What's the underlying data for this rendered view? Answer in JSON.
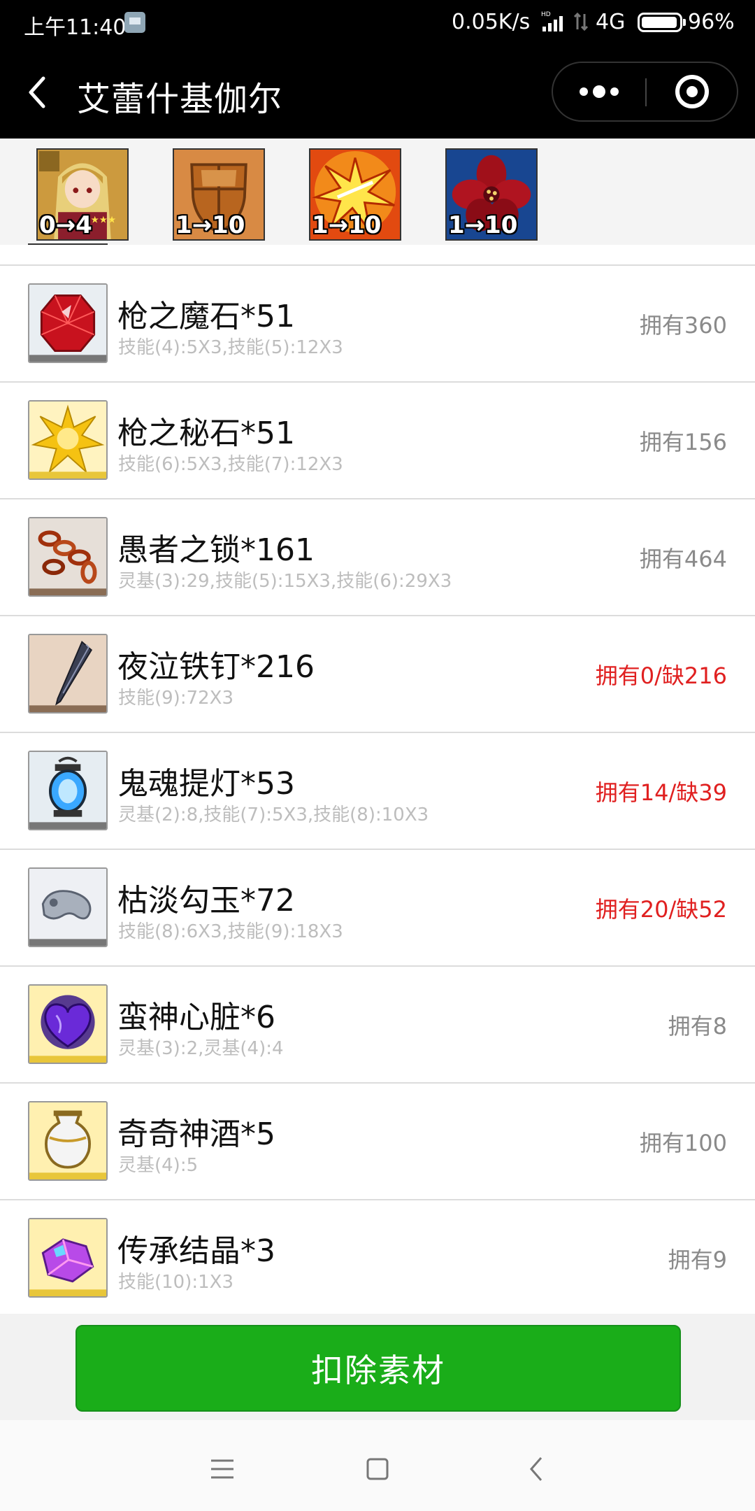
{
  "status_bar": {
    "time": "上午11:40",
    "net_speed": "0.05K/s",
    "network": "4G",
    "battery": "96%"
  },
  "header": {
    "title": "艾蕾什基伽尔"
  },
  "tabs": [
    {
      "label": "0→4",
      "icon": "servant-portrait"
    },
    {
      "label": "1→10",
      "icon": "shield-skill-icon"
    },
    {
      "label": "1→10",
      "icon": "burst-skill-icon"
    },
    {
      "label": "1→10",
      "icon": "red-flower-skill-icon"
    }
  ],
  "materials": [
    {
      "name": "枪之魔石*51",
      "detail": "技能(4):5X3,技能(5):12X3",
      "owned": "拥有360",
      "short": false,
      "icon": "red-gem-icon"
    },
    {
      "name": "枪之秘石*51",
      "detail": "技能(6):5X3,技能(7):12X3",
      "owned": "拥有156",
      "short": false,
      "icon": "gold-star-gem-icon"
    },
    {
      "name": "愚者之锁*161",
      "detail": "灵基(3):29,技能(5):15X3,技能(6):29X3",
      "owned": "拥有464",
      "short": false,
      "icon": "chain-icon"
    },
    {
      "name": "夜泣铁钉*216",
      "detail": "技能(9):72X3",
      "owned": "拥有0/缺216",
      "short": true,
      "icon": "iron-nail-icon"
    },
    {
      "name": "鬼魂提灯*53",
      "detail": "灵基(2):8,技能(7):5X3,技能(8):10X3",
      "owned": "拥有14/缺39",
      "short": true,
      "icon": "lantern-icon"
    },
    {
      "name": "枯淡勾玉*72",
      "detail": "技能(8):6X3,技能(9):18X3",
      "owned": "拥有20/缺52",
      "short": true,
      "icon": "magatama-icon"
    },
    {
      "name": "蛮神心脏*6",
      "detail": "灵基(3):2,灵基(4):4",
      "owned": "拥有8",
      "short": false,
      "icon": "heart-icon"
    },
    {
      "name": "奇奇神酒*5",
      "detail": "灵基(4):5",
      "owned": "拥有100",
      "short": false,
      "icon": "wine-jar-icon"
    },
    {
      "name": "传承结晶*3",
      "detail": "技能(10):1X3",
      "owned": "拥有9",
      "short": false,
      "icon": "crystal-icon"
    }
  ],
  "footer": {
    "deduct_label": "扣除素材"
  },
  "colors": {
    "accent_green": "#1aad19",
    "shortage_red": "#e02020",
    "owned_gray": "#8a8a8a"
  }
}
